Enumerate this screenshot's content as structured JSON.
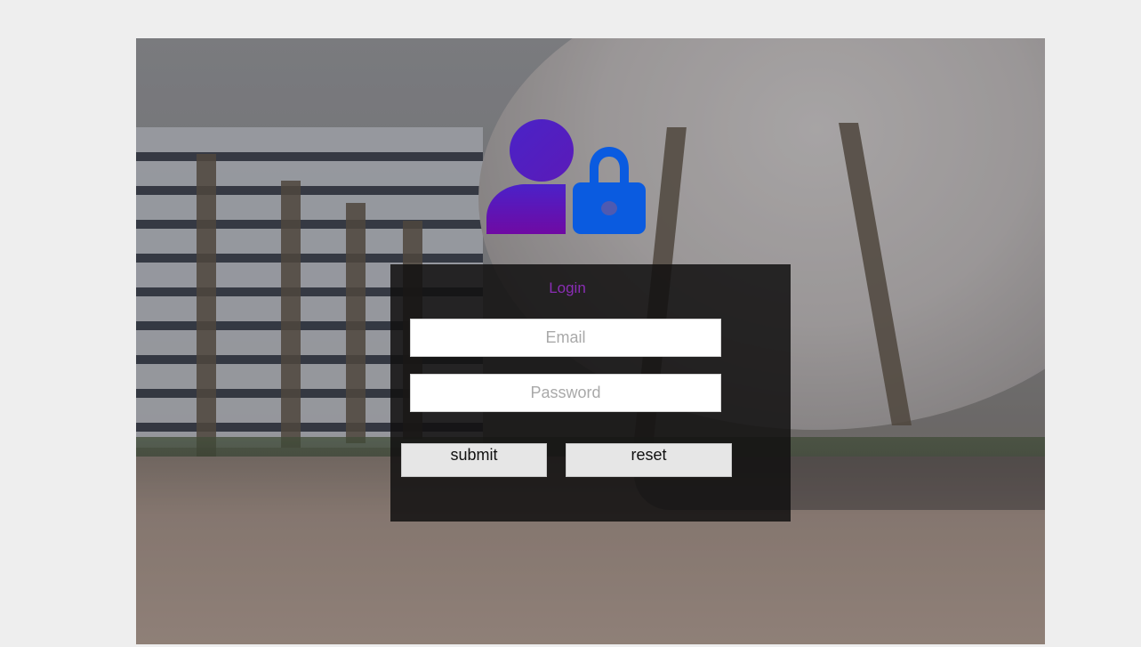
{
  "login": {
    "title": "Login",
    "email_placeholder": "Email",
    "password_placeholder": "Password",
    "submit_label": "submit",
    "reset_label": "reset"
  },
  "logo": {
    "icon": "user-lock-icon",
    "user_color_top": "#4b21c9",
    "user_color_bottom": "#6f0aa3",
    "lock_color": "#0a5be0"
  },
  "colors": {
    "page_background": "#eeeeee",
    "title": "#8a2db5",
    "button_background": "#e6e6e6"
  }
}
